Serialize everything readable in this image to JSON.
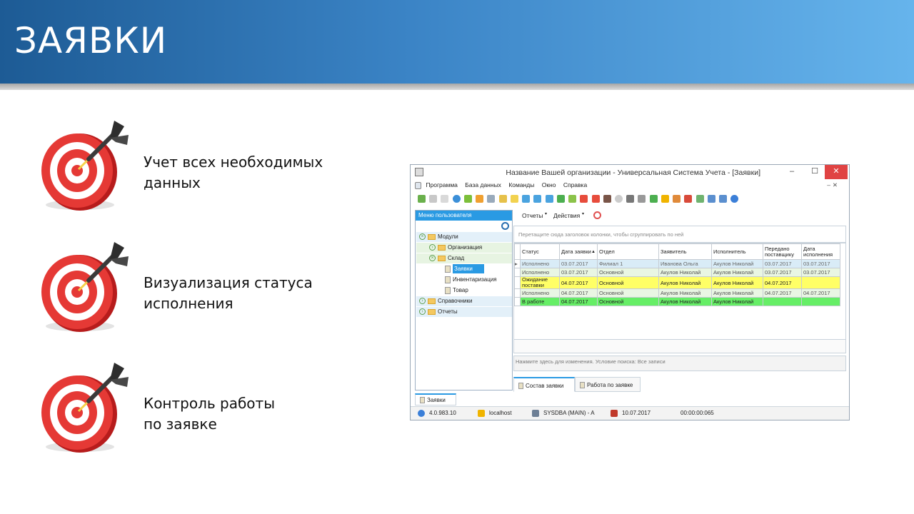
{
  "slide": {
    "title": "ЗАЯВКИ",
    "bullets": [
      {
        "line1": "Учет всех необходимых",
        "line2": "данных",
        "icon": "target-dart-icon"
      },
      {
        "line1": "Визуализация статуса",
        "line2": "исполнения",
        "icon": "target-dart-icon"
      },
      {
        "line1": "Контроль работы",
        "line2": "по заявке",
        "icon": "target-dart-icon"
      }
    ]
  },
  "window": {
    "title": "Название Вашей организации - Универсальная Система Учета - [Заявки]",
    "controls": {
      "minimize": "–",
      "maximize": "☐",
      "close": "✕"
    },
    "menu": [
      "Программа",
      "База данных",
      "Команды",
      "Окно",
      "Справка"
    ],
    "mdi_controls": {
      "minimize": "–",
      "restore": "🗗",
      "close": "✕"
    },
    "left_panel": {
      "header": "Меню пользователя",
      "tree": [
        {
          "label": "Модули",
          "level": 0,
          "type": "folder",
          "expanded": true
        },
        {
          "label": "Организация",
          "level": 1,
          "type": "folder",
          "expanded": false
        },
        {
          "label": "Склад",
          "level": 1,
          "type": "folder",
          "expanded": true
        },
        {
          "label": "Заявки",
          "level": 2,
          "type": "doc",
          "selected": true
        },
        {
          "label": "Инвентаризация",
          "level": 2,
          "type": "doc"
        },
        {
          "label": "Товар",
          "level": 2,
          "type": "doc"
        },
        {
          "label": "Справочники",
          "level": 0,
          "type": "folder",
          "expanded": false
        },
        {
          "label": "Отчеты",
          "level": 0,
          "type": "folder",
          "expanded": false
        }
      ]
    },
    "subtoolbar": {
      "reports": "Отчеты",
      "actions": "Действия"
    },
    "group_hint": "Перетащите сюда заголовок колонки, чтобы сгруппировать по ней",
    "grid": {
      "columns": [
        "Статус",
        "Дата заявки",
        "Отдел",
        "Заявитель",
        "Исполнитель",
        "Передано поставщику",
        "Дата исполнения"
      ],
      "rows": [
        {
          "cells": [
            "Исполнено",
            "03.07.2017",
            "Филиал 1",
            "Иванова Ольга",
            "Акулов Николай",
            "03.07.2017",
            "03.07.2017"
          ],
          "color": "#d9ecf7",
          "textColor": "#666666",
          "current": true
        },
        {
          "cells": [
            "Исполнено",
            "03.07.2017",
            "Основной",
            "Акулов Николай",
            "Акулов Николай",
            "03.07.2017",
            "03.07.2017"
          ],
          "color": "#e9f6e3",
          "textColor": "#555555"
        },
        {
          "cells": [
            "Ожидание поставки",
            "04.07.2017",
            "Основной",
            "Акулов Николай",
            "Акулов Николай",
            "04.07.2017",
            ""
          ],
          "color": "#ffff66",
          "textColor": "#222222"
        },
        {
          "cells": [
            "Исполнено",
            "04.07.2017",
            "Основной",
            "Акулов Николай",
            "Акулов Николай",
            "04.07.2017",
            "04.07.2017"
          ],
          "color": "#e9f6e3",
          "textColor": "#555555"
        },
        {
          "cells": [
            "В работе",
            "04.07.2017",
            "Основной",
            "Акулов Николай",
            "Акулов Николай",
            "",
            ""
          ],
          "color": "#66ee66",
          "textColor": "#222222"
        }
      ]
    },
    "filter_text": "Нажмите здесь для изменения. Условие поиска: Все записи",
    "bottom_tabs": [
      "Состав заявки",
      "Работа по заявке"
    ],
    "doc_tab": "Заявки",
    "status": {
      "version": "4.0.983.10",
      "server": "localhost",
      "user": "SYSDBA (MAIN) - A",
      "date": "10.07.2017",
      "timer": "00:00:00:065"
    }
  }
}
